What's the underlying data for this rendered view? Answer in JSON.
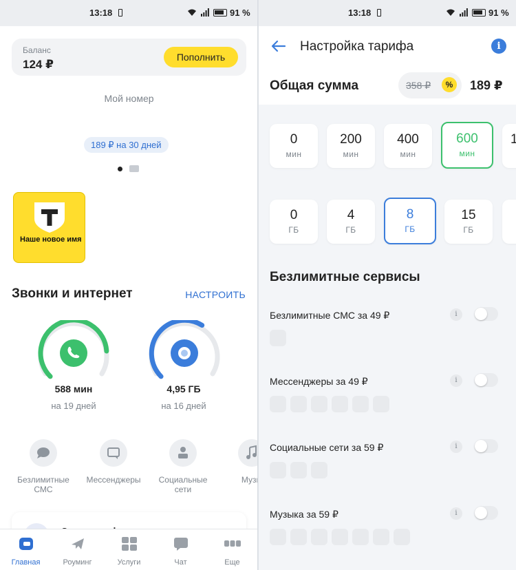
{
  "status": {
    "time": "13:18",
    "battery": "91 %"
  },
  "left": {
    "balance": {
      "label": "Баланс",
      "value": "124 ₽",
      "topup": "Пополнить"
    },
    "my_number": "Мой номер",
    "tariff_pill": "189 ₽ на 30 дней",
    "brand": {
      "text": "Наше новое имя"
    },
    "section": {
      "title": "Звонки и интернет",
      "link": "НАСТРОИТЬ"
    },
    "minutes": {
      "value": "588 мин",
      "sub": "на 19 дней",
      "fill": 0.82
    },
    "data": {
      "value": "4,95 ГБ",
      "sub": "на 16 дней",
      "fill": 0.62
    },
    "services": [
      "Безлимитные СМС",
      "Мессенджеры",
      "Социальные сети",
      "Музы"
    ],
    "partial_card": "Звонки и финансы",
    "tabs": [
      "Главная",
      "Роуминг",
      "Услуги",
      "Чат",
      "Еще"
    ]
  },
  "right": {
    "title": "Настройка тарифа",
    "total_label": "Общая сумма",
    "old_price": "358 ₽",
    "discount_icon": "%",
    "new_price": "189 ₽",
    "minutes_options": [
      {
        "n": "0",
        "u": "мин"
      },
      {
        "n": "200",
        "u": "мин"
      },
      {
        "n": "400",
        "u": "мин"
      },
      {
        "n": "600",
        "u": "мин"
      },
      {
        "n": "1",
        "u": ""
      }
    ],
    "gb_options": [
      {
        "n": "0",
        "u": "ГБ"
      },
      {
        "n": "4",
        "u": "ГБ"
      },
      {
        "n": "8",
        "u": "ГБ"
      },
      {
        "n": "15",
        "u": "ГБ"
      }
    ],
    "unlimited_title": "Безлимитные сервисы",
    "unlimited": [
      {
        "name": "Безлимитные СМС за 49 ₽",
        "icons": 1
      },
      {
        "name": "Мессенджеры за 49 ₽",
        "icons": 6
      },
      {
        "name": "Социальные сети за 59 ₽",
        "icons": 3
      },
      {
        "name": "Музыка за 59 ₽",
        "icons": 7
      }
    ]
  },
  "colors": {
    "accent_blue": "#2f6fd1",
    "green": "#3cc06d",
    "yellow": "#ffdd2d"
  }
}
